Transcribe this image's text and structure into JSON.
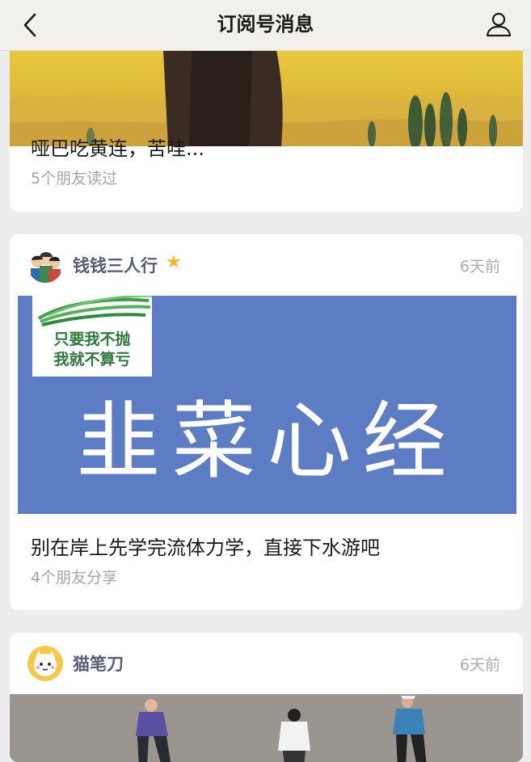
{
  "navbar": {
    "title": "订阅号消息",
    "back_icon": "chevron-left-icon",
    "user_icon": "user-icon"
  },
  "cards": [
    {
      "title": "哑巴吃黄连，苦哇...",
      "meta": "5个朋友读过"
    },
    {
      "account": "钱钱三人行",
      "starred": true,
      "time": "6天前",
      "cover_note_line1": "只要我不抛",
      "cover_note_line2": "我就不算亏",
      "cover_text": "韭菜心经",
      "title": "别在岸上先学完流体力学，直接下水游吧",
      "meta": "4个朋友分享"
    },
    {
      "account": "猫笔刀",
      "time": "6天前"
    }
  ],
  "colors": {
    "background": "#ededed",
    "account_name": "#56607a",
    "star": "#f5b622",
    "cover_blue": "#5c7cc4"
  }
}
